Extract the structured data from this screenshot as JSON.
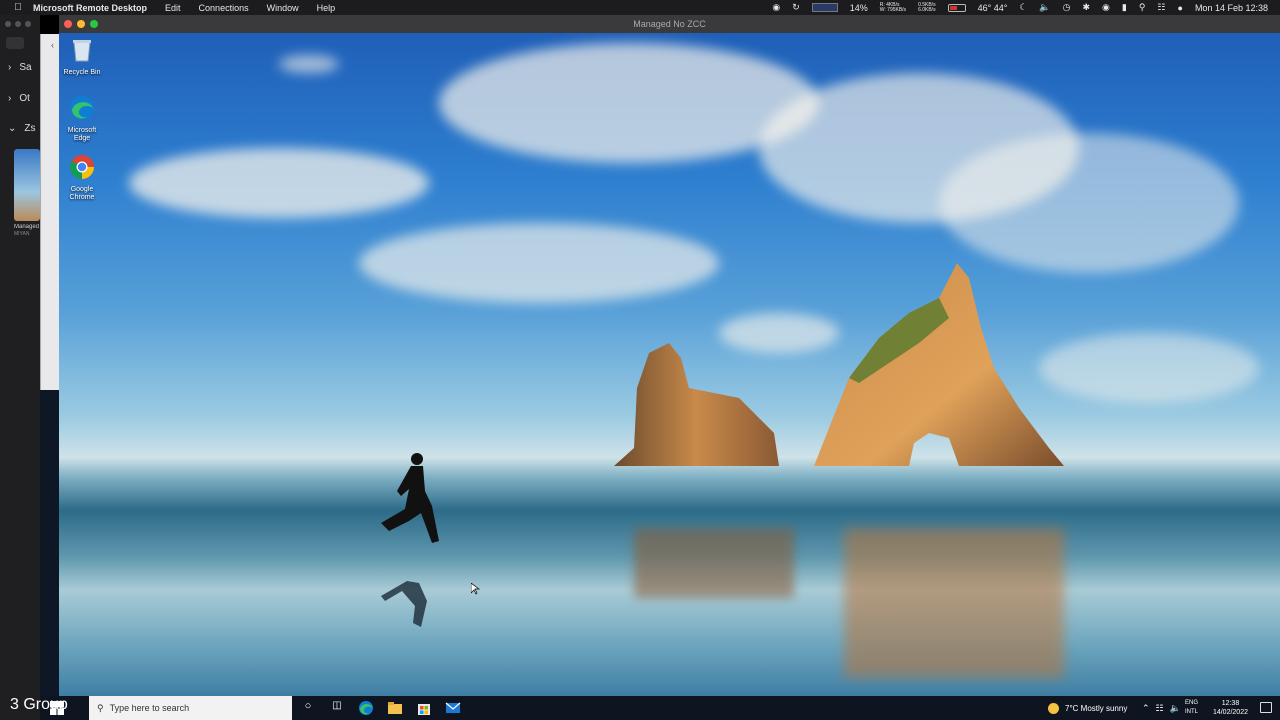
{
  "mac_menubar": {
    "app_name": "Microsoft Remote Desktop",
    "menus": [
      "Edit",
      "Connections",
      "Window",
      "Help"
    ],
    "cpu_percent": "14%",
    "net_upload": "R: 4KB/s",
    "net_download": "W: 795KB/s",
    "net_speed_up": "0.5KB/s",
    "net_speed_down": "6.0KB/s",
    "temperature": "46° 44°",
    "date_time": "Mon 14 Feb  12:38"
  },
  "sidebar": {
    "groups": [
      {
        "label": "Sa",
        "expanded": false
      },
      {
        "label": "Ot",
        "expanded": false
      },
      {
        "label": "Zs",
        "expanded": true
      }
    ],
    "pc_thumbnail_label": "Managed",
    "pc_thumbnail_sub": "MIYAN",
    "group_count": "3 Group"
  },
  "window": {
    "title": "Managed No ZCC"
  },
  "desktop_icons": [
    {
      "label": "Recycle Bin",
      "icon": "recycle-bin-icon"
    },
    {
      "label": "Microsoft Edge",
      "icon": "edge-icon"
    },
    {
      "label": "Google Chrome",
      "icon": "chrome-icon"
    }
  ],
  "taskbar": {
    "search_placeholder": "Type here to search",
    "weather": "7°C  Mostly sunny",
    "lang_top": "ENG",
    "lang_bottom": "INTL",
    "time": "12:38",
    "date": "14/02/2022"
  },
  "colors": {
    "edge_blue": "#0f7dd4",
    "edge_green": "#36c26a",
    "chrome_red": "#db4437",
    "chrome_yellow": "#f4c20d",
    "chrome_green": "#0f9d58",
    "chrome_blue": "#4285f4"
  }
}
